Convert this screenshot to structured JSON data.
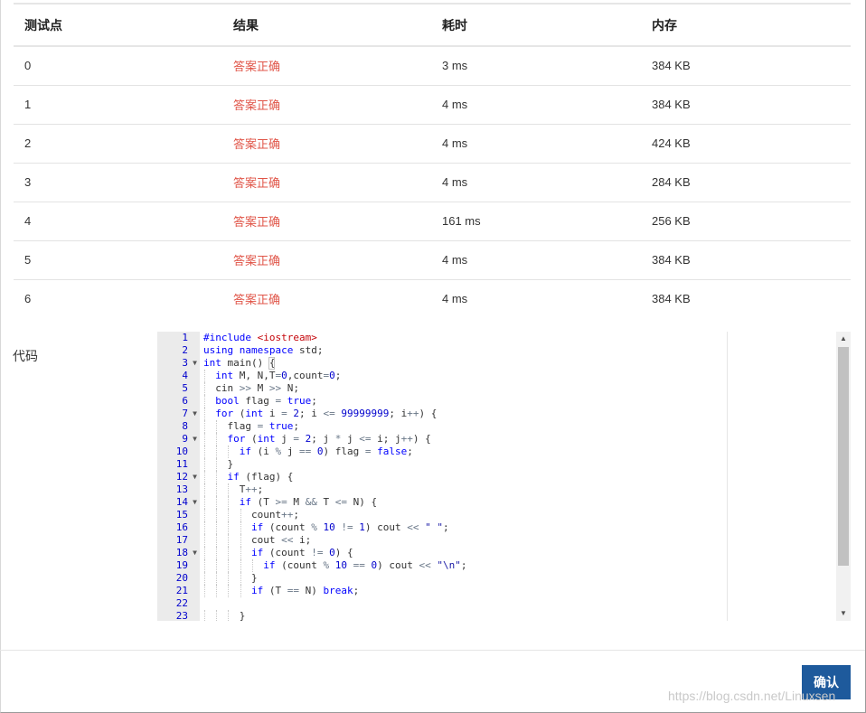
{
  "table": {
    "headers": [
      "测试点",
      "结果",
      "耗时",
      "内存"
    ],
    "rows": [
      {
        "point": "0",
        "result": "答案正确",
        "time": "3 ms",
        "memory": "384 KB"
      },
      {
        "point": "1",
        "result": "答案正确",
        "time": "4 ms",
        "memory": "384 KB"
      },
      {
        "point": "2",
        "result": "答案正确",
        "time": "4 ms",
        "memory": "424 KB"
      },
      {
        "point": "3",
        "result": "答案正确",
        "time": "4 ms",
        "memory": "284 KB"
      },
      {
        "point": "4",
        "result": "答案正确",
        "time": "161 ms",
        "memory": "256 KB"
      },
      {
        "point": "5",
        "result": "答案正确",
        "time": "4 ms",
        "memory": "384 KB"
      },
      {
        "point": "6",
        "result": "答案正确",
        "time": "4 ms",
        "memory": "384 KB"
      }
    ]
  },
  "code_section": {
    "label": "代码",
    "lines": [
      "#include <iostream>",
      "using namespace std;",
      "int main() {",
      "  int M, N,T=0,count=0;",
      "  cin >> M >> N;",
      "  bool flag = true;",
      "  for (int i = 2; i <= 99999999; i++) {",
      "    flag = true;",
      "    for (int j = 2; j * j <= i; j++) {",
      "      if (i % j == 0) flag = false;",
      "    }",
      "    if (flag) {",
      "      T++;",
      "      if (T >= M && T <= N) {",
      "        count++;",
      "        if (count % 10 != 1) cout << \" \";",
      "        cout << i;",
      "        if (count != 0) {",
      "          if (count % 10 == 0) cout << \"\\n\";",
      "        }",
      "        if (T == N) break;",
      "",
      "      }"
    ],
    "fold_lines": [
      3,
      7,
      9,
      12,
      14,
      18
    ]
  },
  "footer": {
    "confirm_label": "确认",
    "watermark": "https://blog.csdn.net/Linuxsen"
  },
  "colors": {
    "status_ok": "#e05548",
    "button_bg": "#1e5a9c",
    "keyword": "#0000ff"
  },
  "icons": {
    "fold_marker": "caret-down-icon",
    "scroll_up": "triangle-up-icon",
    "scroll_down": "triangle-down-icon"
  }
}
